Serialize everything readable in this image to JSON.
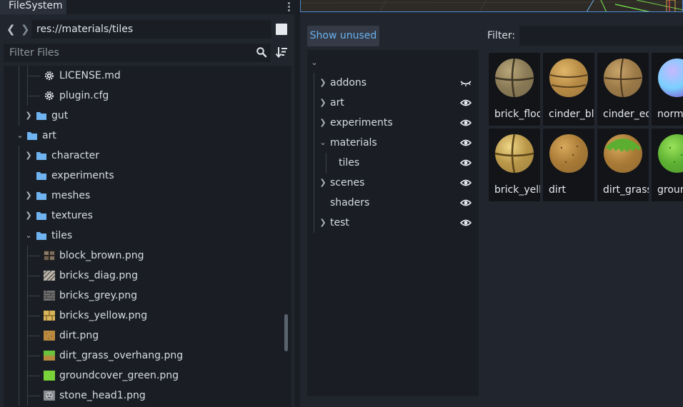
{
  "filesystem": {
    "tab_label": "FileSystem",
    "path": "res://materials/tiles",
    "filter_placeholder": "Filter Files",
    "tree": [
      {
        "label": "LICENSE.md",
        "icon": "gear-icon"
      },
      {
        "label": "plugin.cfg",
        "icon": "gear-icon"
      },
      {
        "label": "gut",
        "icon": "folder-icon",
        "expanded": false
      },
      {
        "label": "art",
        "icon": "folder-icon",
        "expanded": true
      },
      {
        "label": "character",
        "icon": "folder-icon",
        "expanded": false
      },
      {
        "label": "experiments",
        "icon": "folder-icon"
      },
      {
        "label": "meshes",
        "icon": "folder-icon",
        "expanded": false
      },
      {
        "label": "textures",
        "icon": "folder-icon",
        "expanded": false
      },
      {
        "label": "tiles",
        "icon": "folder-icon",
        "expanded": true
      },
      {
        "label": "block_brown.png",
        "icon": "block-brown-thumbnail-icon"
      },
      {
        "label": "bricks_diag.png",
        "icon": "bricks-diag-thumbnail-icon"
      },
      {
        "label": "bricks_grey.png",
        "icon": "bricks-grey-thumbnail-icon"
      },
      {
        "label": "bricks_yellow.png",
        "icon": "bricks-yellow-thumbnail-icon"
      },
      {
        "label": "dirt.png",
        "icon": "dirt-thumbnail-icon"
      },
      {
        "label": "dirt_grass_overhang.png",
        "icon": "dirt-grass-thumbnail-icon"
      },
      {
        "label": "groundcover_green.png",
        "icon": "groundcover-green-thumbnail-icon"
      },
      {
        "label": "stone_head1.png",
        "icon": "stone-head-thumbnail-icon"
      }
    ]
  },
  "dialog": {
    "show_unused_label": "Show unused",
    "filter_label": "Filter:",
    "filter_value": "",
    "directories": [
      {
        "label": "addons",
        "visible": false
      },
      {
        "label": "art",
        "visible": true
      },
      {
        "label": "experiments",
        "visible": true
      },
      {
        "label": "materials",
        "visible": true
      },
      {
        "label": "tiles",
        "visible": true
      },
      {
        "label": "scenes",
        "visible": true
      },
      {
        "label": "shaders",
        "visible": true
      },
      {
        "label": "test",
        "visible": true
      }
    ],
    "assets": [
      {
        "name": "brick_floor",
        "material": "brick-floor"
      },
      {
        "name": "cinder_block",
        "material": "cinder-block"
      },
      {
        "name": "cinder_edge",
        "material": "cinder-edge"
      },
      {
        "name": "normal",
        "material": "normal"
      },
      {
        "name": "brick_yellow",
        "material": "brick-yellow"
      },
      {
        "name": "dirt",
        "material": "dirt"
      },
      {
        "name": "dirt_grass",
        "material": "dirt-grass"
      },
      {
        "name": "groundcover",
        "material": "groundcover"
      }
    ]
  },
  "colors": {
    "accent": "#4b86d1",
    "folder": "#6fb3f0",
    "link_text": "#6ab0ee"
  }
}
